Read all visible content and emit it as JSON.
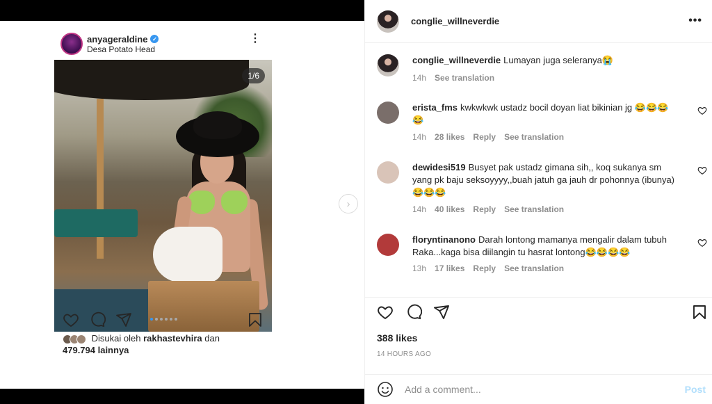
{
  "embedded_post": {
    "username": "anyageraldine",
    "location": "Desa Potato Head",
    "photo_counter": "1/6",
    "carousel_dots": 6,
    "active_dot": 1,
    "liked_by_prefix": "Disukai oleh",
    "liked_by_user": "rakhastevhira",
    "liked_by_and": "dan",
    "liked_by_count": "479.794 lainnya"
  },
  "post": {
    "owner": "conglie_willneverdie"
  },
  "comments": [
    {
      "username": "conglie_willneverdie",
      "text": "Lumayan juga seleranya😭",
      "time": "14h",
      "likes": "",
      "reply": "",
      "translation": "See translation",
      "avatar_color": "#2a2224",
      "has_heart": false
    },
    {
      "username": "erista_fms",
      "text": "kwkwkwk ustadz bocil doyan liat bikinian jg 😂😂😂😂",
      "time": "14h",
      "likes": "28 likes",
      "reply": "Reply",
      "translation": "See translation",
      "avatar_color": "#7a6e6a",
      "has_heart": true
    },
    {
      "username": "dewidesi519",
      "text": "Busyet pak ustadz gimana sih,, koq sukanya sm yang pk baju seksoyyyy,,buah jatuh ga jauh dr pohonnya (ibunya) 😂😂😂",
      "time": "14h",
      "likes": "40 likes",
      "reply": "Reply",
      "translation": "See translation",
      "avatar_color": "#d9c4b8",
      "has_heart": true
    },
    {
      "username": "floryntinanono",
      "text": "Darah lontong mamanya mengalir dalam tubuh Raka...kaga bisa diilangin tu hasrat lontong😂😂😂😂",
      "time": "13h",
      "likes": "17 likes",
      "reply": "Reply",
      "translation": "See translation",
      "avatar_color": "#b23a3a",
      "has_heart": true
    }
  ],
  "stats": {
    "likes": "388 likes",
    "time": "14 HOURS AGO"
  },
  "composer": {
    "placeholder": "Add a comment...",
    "post_label": "Post"
  },
  "icons": {
    "more": "more-dots-icon",
    "heart": "heart-icon",
    "comment": "comment-icon",
    "share": "share-icon",
    "bookmark": "bookmark-icon",
    "emoji": "emoji-icon",
    "next": "chevron-right-icon",
    "verified": "verified-badge-icon"
  },
  "colors": {
    "link_blue": "#3897f0",
    "post_disabled": "#b2dffc",
    "meta_gray": "#8e8e8e"
  }
}
